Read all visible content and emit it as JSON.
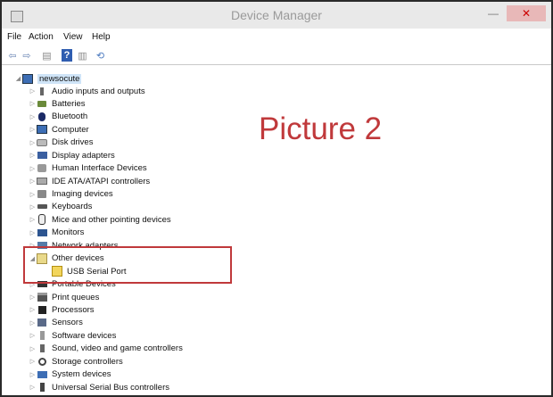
{
  "window": {
    "title": "Device Manager",
    "minimize_glyph": "—",
    "close_glyph": "✕"
  },
  "menu": [
    {
      "label": "File"
    },
    {
      "label": "Action"
    },
    {
      "label": "View"
    },
    {
      "label": "Help"
    }
  ],
  "toolbar": [
    {
      "icon": "back-arrow-icon",
      "glyph": "⇦"
    },
    {
      "icon": "forward-arrow-icon",
      "glyph": "⇨"
    },
    {
      "icon": "properties-icon",
      "glyph": "▤"
    },
    {
      "icon": "help-icon",
      "glyph": "?"
    },
    {
      "icon": "view-icon",
      "glyph": "▥"
    },
    {
      "icon": "scan-hardware-icon",
      "glyph": "⟲"
    }
  ],
  "tree": {
    "root": {
      "label": "newsocute",
      "arrow": "◢",
      "icon": "computer-icon"
    },
    "categories": [
      {
        "label": "Audio inputs and outputs",
        "arrow": "▷",
        "icon": "audio"
      },
      {
        "label": "Batteries",
        "arrow": "▷",
        "icon": "battery"
      },
      {
        "label": "Bluetooth",
        "arrow": "▷",
        "icon": "bt"
      },
      {
        "label": "Computer",
        "arrow": "▷",
        "icon": "computer"
      },
      {
        "label": "Disk drives",
        "arrow": "▷",
        "icon": "disk"
      },
      {
        "label": "Display adapters",
        "arrow": "▷",
        "icon": "display"
      },
      {
        "label": "Human Interface Devices",
        "arrow": "▷",
        "icon": "hid"
      },
      {
        "label": "IDE ATA/ATAPI controllers",
        "arrow": "▷",
        "icon": "ide"
      },
      {
        "label": "Imaging devices",
        "arrow": "▷",
        "icon": "imaging"
      },
      {
        "label": "Keyboards",
        "arrow": "▷",
        "icon": "keyboard"
      },
      {
        "label": "Mice and other pointing devices",
        "arrow": "▷",
        "icon": "mouse"
      },
      {
        "label": "Monitors",
        "arrow": "▷",
        "icon": "monitor"
      },
      {
        "label": "Network adapters",
        "arrow": "▷",
        "icon": "network"
      },
      {
        "label": "Other devices",
        "arrow": "◢",
        "icon": "other",
        "expanded": true
      },
      {
        "label": "USB Serial Port",
        "arrow": "",
        "icon": "usbwarn",
        "child": true
      },
      {
        "label": "Portable Devices",
        "arrow": "▷",
        "icon": "portable"
      },
      {
        "label": "Print queues",
        "arrow": "▷",
        "icon": "printer"
      },
      {
        "label": "Processors",
        "arrow": "▷",
        "icon": "processor"
      },
      {
        "label": "Sensors",
        "arrow": "▷",
        "icon": "sensors"
      },
      {
        "label": "Software devices",
        "arrow": "▷",
        "icon": "software"
      },
      {
        "label": "Sound, video and game controllers",
        "arrow": "▷",
        "icon": "sound"
      },
      {
        "label": "Storage controllers",
        "arrow": "▷",
        "icon": "storage"
      },
      {
        "label": "System devices",
        "arrow": "▷",
        "icon": "system"
      },
      {
        "label": "Universal Serial Bus controllers",
        "arrow": "▷",
        "icon": "usb"
      }
    ]
  },
  "annotation": {
    "text": "Picture 2",
    "color": "#c0393b"
  }
}
